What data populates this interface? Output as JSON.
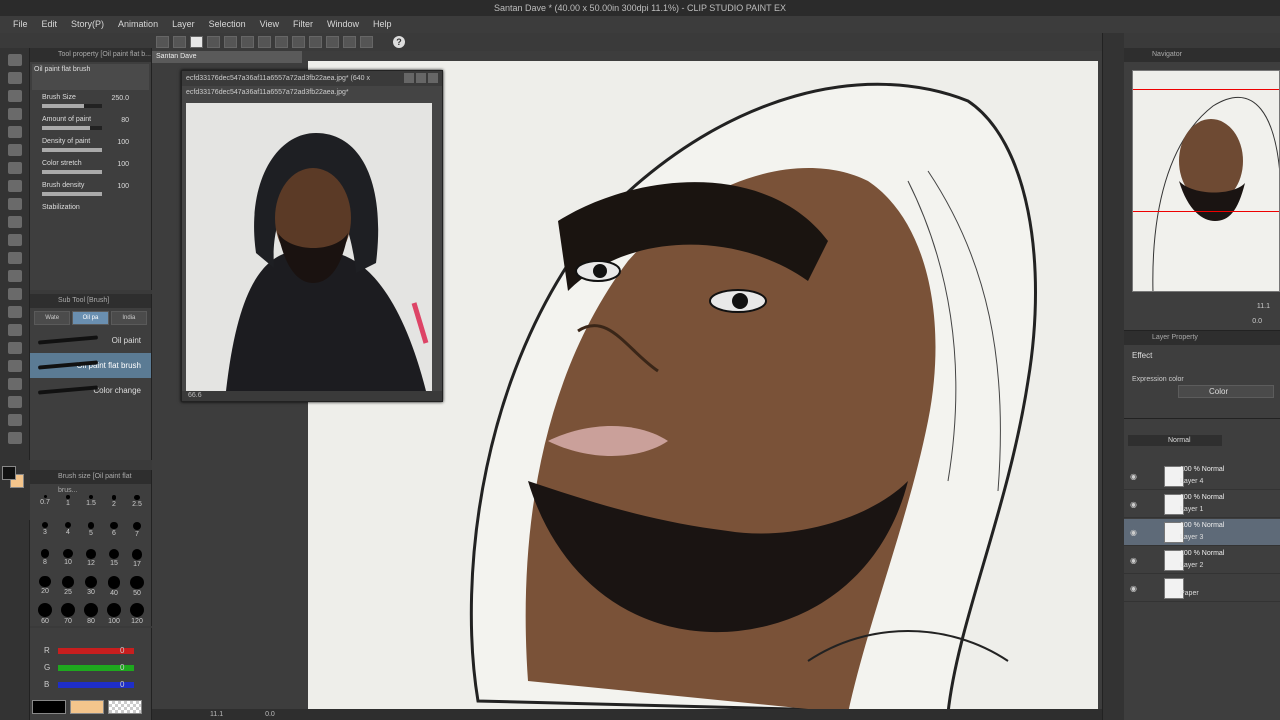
{
  "window": {
    "title": "Santan Dave * (40.00 x 50.00in 300dpi 11.1%) - CLIP STUDIO PAINT EX"
  },
  "menu": [
    "File",
    "Edit",
    "Story(P)",
    "Animation",
    "Layer",
    "Selection",
    "View",
    "Filter",
    "Window",
    "Help"
  ],
  "tool_property": {
    "header": "Tool property [Oil paint flat b...",
    "brush_name": "Oil paint flat brush",
    "props": [
      {
        "label": "Brush Size",
        "value": "250.0",
        "level": 0.7
      },
      {
        "label": "Amount of paint",
        "value": "80",
        "level": 0.8
      },
      {
        "label": "Density of paint",
        "value": "100",
        "level": 1.0
      },
      {
        "label": "Color stretch",
        "value": "100",
        "level": 1.0
      },
      {
        "label": "Brush density",
        "value": "100",
        "level": 1.0
      },
      {
        "label": "Stabilization",
        "value": "",
        "level": 0.0
      }
    ]
  },
  "sub_tool": {
    "header": "Sub Tool [Brush]",
    "tabs": [
      "Wate",
      "Oil pa",
      "India"
    ],
    "active_tab": 1,
    "brushes": [
      {
        "label": "Oil paint",
        "selected": false
      },
      {
        "label": "Oil paint flat brush",
        "selected": true
      },
      {
        "label": "Color change",
        "selected": false
      }
    ]
  },
  "brush_size": {
    "header": "Brush size [Oil paint flat brus...",
    "sizes": [
      "0.7",
      "1",
      "1.5",
      "2",
      "2.5",
      "3",
      "4",
      "5",
      "6",
      "7",
      "8",
      "10",
      "12",
      "15",
      "17",
      "20",
      "25",
      "30",
      "40",
      "50",
      "60",
      "70",
      "80",
      "100",
      "120"
    ]
  },
  "color": {
    "rows": [
      {
        "label": "R",
        "value": "0",
        "color": "#c81e1e"
      },
      {
        "label": "G",
        "value": "0",
        "color": "#1ea81e"
      },
      {
        "label": "B",
        "value": "0",
        "color": "#1e2ec8"
      }
    ],
    "main": "#000000",
    "sub": "#f4c58c"
  },
  "canvas": {
    "tab": "Santan Dave",
    "ref_title": "ecfd33176dec547a36af11a6557a72ad3fb22aea.jpg* (640 x",
    "ref_subtitle": "ecfd33176dec547a36af11a6557a72ad3fb22aea.jpg*",
    "ref_zoom": "66.6",
    "zoom": "11.1",
    "rotation": "0.0"
  },
  "navigator": {
    "header": "Navigator",
    "zoom": "11.1",
    "rotation": "0.0"
  },
  "layer_property": {
    "header": "Layer Property",
    "effect_label": "Effect",
    "expression_label": "Expression color",
    "expression_value": "Color"
  },
  "layers": {
    "blend": "Normal",
    "items": [
      {
        "mode": "100 % Normal",
        "name": "Layer 4",
        "selected": false
      },
      {
        "mode": "100 % Normal",
        "name": "Layer 1",
        "selected": false
      },
      {
        "mode": "100 % Normal",
        "name": "Layer 3",
        "selected": true
      },
      {
        "mode": "100 % Normal",
        "name": "Layer 2",
        "selected": false
      },
      {
        "mode": "",
        "name": "Paper",
        "selected": false
      }
    ]
  }
}
